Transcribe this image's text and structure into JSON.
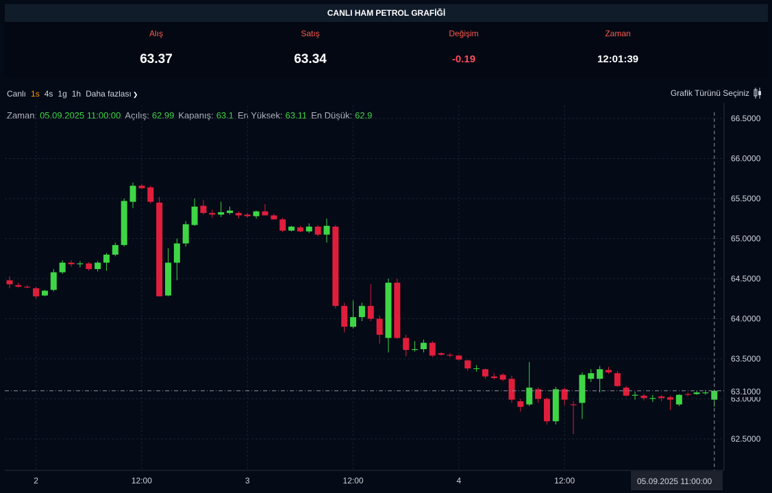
{
  "header": {
    "title": "CANLI HAM PETROL GRAFİĞİ"
  },
  "stats": {
    "bid_label": "Alış",
    "bid": "63.37",
    "ask_label": "Satış",
    "ask": "63.34",
    "change_label": "Değişim",
    "change": "-0.19",
    "time_label": "Zaman",
    "time": "12:01:39"
  },
  "toolbar": {
    "live": "Canlı",
    "intervals": [
      "1s",
      "4s",
      "1g",
      "1h"
    ],
    "active_interval": "1s",
    "more": "Daha fazlası",
    "chart_type": "Grafik Türünü Seçiniz"
  },
  "ohlc": {
    "time_label": "Zaman:",
    "time": "05.09.2025 11:00:00",
    "open_label": "Açılış:",
    "open": "62.99",
    "close_label": "Kapanış:",
    "close": "63.1",
    "high_label": "En Yüksek:",
    "high": "63.11",
    "low_label": "En Düşük:",
    "low": "62.9"
  },
  "colors": {
    "up": "#3fd646",
    "down": "#e01e3c",
    "accent": "#ff9800",
    "background": "#040a16"
  },
  "chart_data": {
    "type": "candlestick",
    "y_ticks": [
      "66.5000",
      "66.0000",
      "65.5000",
      "65.0000",
      "64.5000",
      "64.0000",
      "63.5000",
      "63.0000",
      "62.5000"
    ],
    "y_tick_values": [
      66.5,
      66.0,
      65.5,
      65.0,
      64.5,
      64.0,
      63.5,
      63.0,
      62.5
    ],
    "ylim": [
      62.2,
      66.6
    ],
    "current_price_label": "63.1000",
    "current_price": 63.1,
    "x_ticks": [
      "2",
      "12:00",
      "3",
      "12:00",
      "4",
      "12:00"
    ],
    "x_tick_indices": [
      3,
      15,
      27,
      39,
      51,
      63
    ],
    "crosshair_time": "05.09.2025",
    "crosshair_hour": "11:00:00",
    "grid": true,
    "candles": [
      {
        "o": 64.48,
        "h": 64.53,
        "l": 64.38,
        "c": 64.43
      },
      {
        "o": 64.42,
        "h": 64.45,
        "l": 64.39,
        "c": 64.4
      },
      {
        "o": 64.4,
        "h": 64.42,
        "l": 64.38,
        "c": 64.39
      },
      {
        "o": 64.38,
        "h": 64.4,
        "l": 64.25,
        "c": 64.28
      },
      {
        "o": 64.29,
        "h": 64.36,
        "l": 64.28,
        "c": 64.35
      },
      {
        "o": 64.36,
        "h": 64.62,
        "l": 64.34,
        "c": 64.58
      },
      {
        "o": 64.58,
        "h": 64.73,
        "l": 64.56,
        "c": 64.7
      },
      {
        "o": 64.7,
        "h": 64.73,
        "l": 64.65,
        "c": 64.68
      },
      {
        "o": 64.68,
        "h": 64.72,
        "l": 64.64,
        "c": 64.69
      },
      {
        "o": 64.69,
        "h": 64.71,
        "l": 64.6,
        "c": 64.62
      },
      {
        "o": 64.62,
        "h": 64.72,
        "l": 64.59,
        "c": 64.7
      },
      {
        "o": 64.7,
        "h": 64.82,
        "l": 64.6,
        "c": 64.8
      },
      {
        "o": 64.8,
        "h": 64.95,
        "l": 64.78,
        "c": 64.92
      },
      {
        "o": 64.92,
        "h": 65.5,
        "l": 64.9,
        "c": 65.47
      },
      {
        "o": 65.46,
        "h": 65.7,
        "l": 65.38,
        "c": 65.66
      },
      {
        "o": 65.66,
        "h": 65.68,
        "l": 65.62,
        "c": 65.63
      },
      {
        "o": 65.64,
        "h": 65.66,
        "l": 65.44,
        "c": 65.46
      },
      {
        "o": 65.45,
        "h": 65.52,
        "l": 64.28,
        "c": 64.28
      },
      {
        "o": 64.29,
        "h": 64.88,
        "l": 64.28,
        "c": 64.7
      },
      {
        "o": 64.7,
        "h": 65.0,
        "l": 64.48,
        "c": 64.94
      },
      {
        "o": 64.94,
        "h": 65.22,
        "l": 64.9,
        "c": 65.18
      },
      {
        "o": 65.17,
        "h": 65.5,
        "l": 65.16,
        "c": 65.4
      },
      {
        "o": 65.41,
        "h": 65.48,
        "l": 65.3,
        "c": 65.32
      },
      {
        "o": 65.32,
        "h": 65.36,
        "l": 65.26,
        "c": 65.3
      },
      {
        "o": 65.3,
        "h": 65.46,
        "l": 65.27,
        "c": 65.33
      },
      {
        "o": 65.32,
        "h": 65.4,
        "l": 65.3,
        "c": 65.35
      },
      {
        "o": 65.32,
        "h": 65.34,
        "l": 65.25,
        "c": 65.29
      },
      {
        "o": 65.3,
        "h": 65.32,
        "l": 65.26,
        "c": 65.28
      },
      {
        "o": 65.28,
        "h": 65.35,
        "l": 65.25,
        "c": 65.34
      },
      {
        "o": 65.34,
        "h": 65.43,
        "l": 65.29,
        "c": 65.29
      },
      {
        "o": 65.29,
        "h": 65.31,
        "l": 65.25,
        "c": 65.24
      },
      {
        "o": 65.24,
        "h": 65.26,
        "l": 65.08,
        "c": 65.1
      },
      {
        "o": 65.1,
        "h": 65.16,
        "l": 65.09,
        "c": 65.15
      },
      {
        "o": 65.14,
        "h": 65.16,
        "l": 65.08,
        "c": 65.09
      },
      {
        "o": 65.09,
        "h": 65.19,
        "l": 65.07,
        "c": 65.15
      },
      {
        "o": 65.15,
        "h": 65.17,
        "l": 65.03,
        "c": 65.05
      },
      {
        "o": 65.05,
        "h": 65.25,
        "l": 64.95,
        "c": 65.16
      },
      {
        "o": 65.15,
        "h": 65.17,
        "l": 64.13,
        "c": 64.16
      },
      {
        "o": 64.16,
        "h": 64.2,
        "l": 63.83,
        "c": 63.9
      },
      {
        "o": 63.9,
        "h": 64.23,
        "l": 63.88,
        "c": 64.02
      },
      {
        "o": 64.02,
        "h": 64.2,
        "l": 63.97,
        "c": 64.16
      },
      {
        "o": 64.16,
        "h": 64.43,
        "l": 63.97,
        "c": 64.0
      },
      {
        "o": 64.0,
        "h": 64.04,
        "l": 63.69,
        "c": 63.8
      },
      {
        "o": 63.76,
        "h": 64.5,
        "l": 63.58,
        "c": 64.45
      },
      {
        "o": 64.45,
        "h": 64.5,
        "l": 63.75,
        "c": 63.76
      },
      {
        "o": 63.76,
        "h": 63.8,
        "l": 63.53,
        "c": 63.61
      },
      {
        "o": 63.61,
        "h": 63.72,
        "l": 63.59,
        "c": 63.62
      },
      {
        "o": 63.62,
        "h": 63.74,
        "l": 63.58,
        "c": 63.7
      },
      {
        "o": 63.7,
        "h": 63.72,
        "l": 63.52,
        "c": 63.54
      },
      {
        "o": 63.57,
        "h": 63.58,
        "l": 63.54,
        "c": 63.55
      },
      {
        "o": 63.55,
        "h": 63.57,
        "l": 63.52,
        "c": 63.54
      },
      {
        "o": 63.54,
        "h": 63.55,
        "l": 63.48,
        "c": 63.49
      },
      {
        "o": 63.48,
        "h": 63.49,
        "l": 63.35,
        "c": 63.38
      },
      {
        "o": 63.38,
        "h": 63.42,
        "l": 63.34,
        "c": 63.38
      },
      {
        "o": 63.37,
        "h": 63.38,
        "l": 63.25,
        "c": 63.28
      },
      {
        "o": 63.28,
        "h": 63.32,
        "l": 63.24,
        "c": 63.26
      },
      {
        "o": 63.3,
        "h": 63.32,
        "l": 63.22,
        "c": 63.24
      },
      {
        "o": 63.25,
        "h": 63.29,
        "l": 62.95,
        "c": 62.99
      },
      {
        "o": 62.97,
        "h": 63.0,
        "l": 62.84,
        "c": 62.9
      },
      {
        "o": 62.93,
        "h": 63.46,
        "l": 62.91,
        "c": 63.14
      },
      {
        "o": 63.12,
        "h": 63.14,
        "l": 62.95,
        "c": 63.0
      },
      {
        "o": 63.0,
        "h": 63.02,
        "l": 62.68,
        "c": 62.72
      },
      {
        "o": 62.72,
        "h": 63.15,
        "l": 62.68,
        "c": 63.12
      },
      {
        "o": 63.12,
        "h": 63.14,
        "l": 62.92,
        "c": 62.99
      },
      {
        "o": 62.93,
        "h": 62.97,
        "l": 62.56,
        "c": 62.92
      },
      {
        "o": 62.95,
        "h": 63.33,
        "l": 62.75,
        "c": 63.3
      },
      {
        "o": 63.25,
        "h": 63.37,
        "l": 63.21,
        "c": 63.32
      },
      {
        "o": 63.25,
        "h": 63.41,
        "l": 63.08,
        "c": 63.37
      },
      {
        "o": 63.36,
        "h": 63.4,
        "l": 63.31,
        "c": 63.33
      },
      {
        "o": 63.32,
        "h": 63.35,
        "l": 63.15,
        "c": 63.16
      },
      {
        "o": 63.14,
        "h": 63.16,
        "l": 63.03,
        "c": 63.04
      },
      {
        "o": 63.04,
        "h": 63.09,
        "l": 62.99,
        "c": 63.05
      },
      {
        "o": 63.04,
        "h": 63.06,
        "l": 62.98,
        "c": 63.01
      },
      {
        "o": 63.0,
        "h": 63.05,
        "l": 62.96,
        "c": 63.01
      },
      {
        "o": 63.03,
        "h": 63.05,
        "l": 62.97,
        "c": 63.01
      },
      {
        "o": 63.02,
        "h": 63.04,
        "l": 62.86,
        "c": 62.99
      },
      {
        "o": 62.93,
        "h": 63.06,
        "l": 62.91,
        "c": 63.05
      },
      {
        "o": 63.06,
        "h": 63.08,
        "l": 63.03,
        "c": 63.05
      },
      {
        "o": 63.06,
        "h": 63.1,
        "l": 63.05,
        "c": 63.08
      },
      {
        "o": 63.07,
        "h": 63.11,
        "l": 63.05,
        "c": 63.08
      },
      {
        "o": 62.99,
        "h": 63.11,
        "l": 62.9,
        "c": 63.1
      }
    ]
  }
}
